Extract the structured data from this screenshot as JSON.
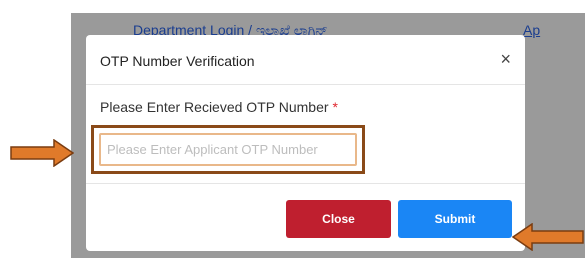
{
  "background": {
    "department_link": "Department Login / ಇಲಾಖೆ ಲಾಗಿನ್",
    "app_link": "Ap"
  },
  "modal": {
    "title": "OTP Number Verification",
    "close_glyph": "×",
    "field_label": "Please Enter Recieved OTP Number",
    "required_mark": "*",
    "otp_placeholder": "Please Enter Applicant OTP Number",
    "otp_value": "",
    "close_button": "Close",
    "submit_button": "Submit"
  },
  "colors": {
    "close_button": "#bf1f2f",
    "submit_button": "#1a86f5",
    "annotation_arrow": "#e07a2a",
    "highlight_border": "#8a4a18"
  },
  "annotations": {
    "arrow_left_icon": "arrow-right-icon",
    "arrow_right_icon": "arrow-left-icon"
  }
}
